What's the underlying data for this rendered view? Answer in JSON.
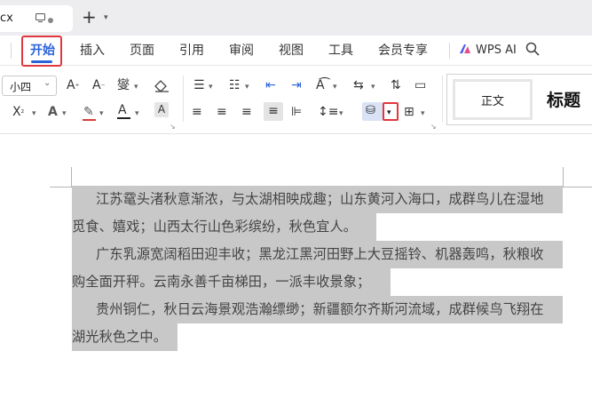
{
  "tabbar": {
    "doc_name": "cx"
  },
  "menu": {
    "items": [
      "开始",
      "插入",
      "页面",
      "引用",
      "审阅",
      "视图",
      "工具",
      "会员专享"
    ],
    "wps_ai": "WPS AI"
  },
  "ribbon": {
    "font_size": "小四",
    "styles": {
      "normal": "正文",
      "title": "标题"
    }
  },
  "document": {
    "lines": [
      "江苏鼋头渚秋意渐浓，与太湖相映成趣；山东黄河入海口，成群鸟儿在湿地",
      "觅食、嬉戏；山西太行山色彩缤纷，秋色宜人。",
      "广东乳源宽阔稻田迎丰收；黑龙江黑河田野上大豆摇铃、机器轰鸣，秋粮收",
      "购全面开秤。云南永善千亩梯田，一派丰收景象；",
      "贵州铜仁，秋日云海景观浩瀚缥缈；新疆额尔齐斯河流域，成群候鸟飞翔在",
      "湖光秋色之中。"
    ]
  },
  "colors": {
    "accent": "#2b63d9",
    "highlight_border": "#e0383e",
    "selection": "#c8c8c8"
  }
}
